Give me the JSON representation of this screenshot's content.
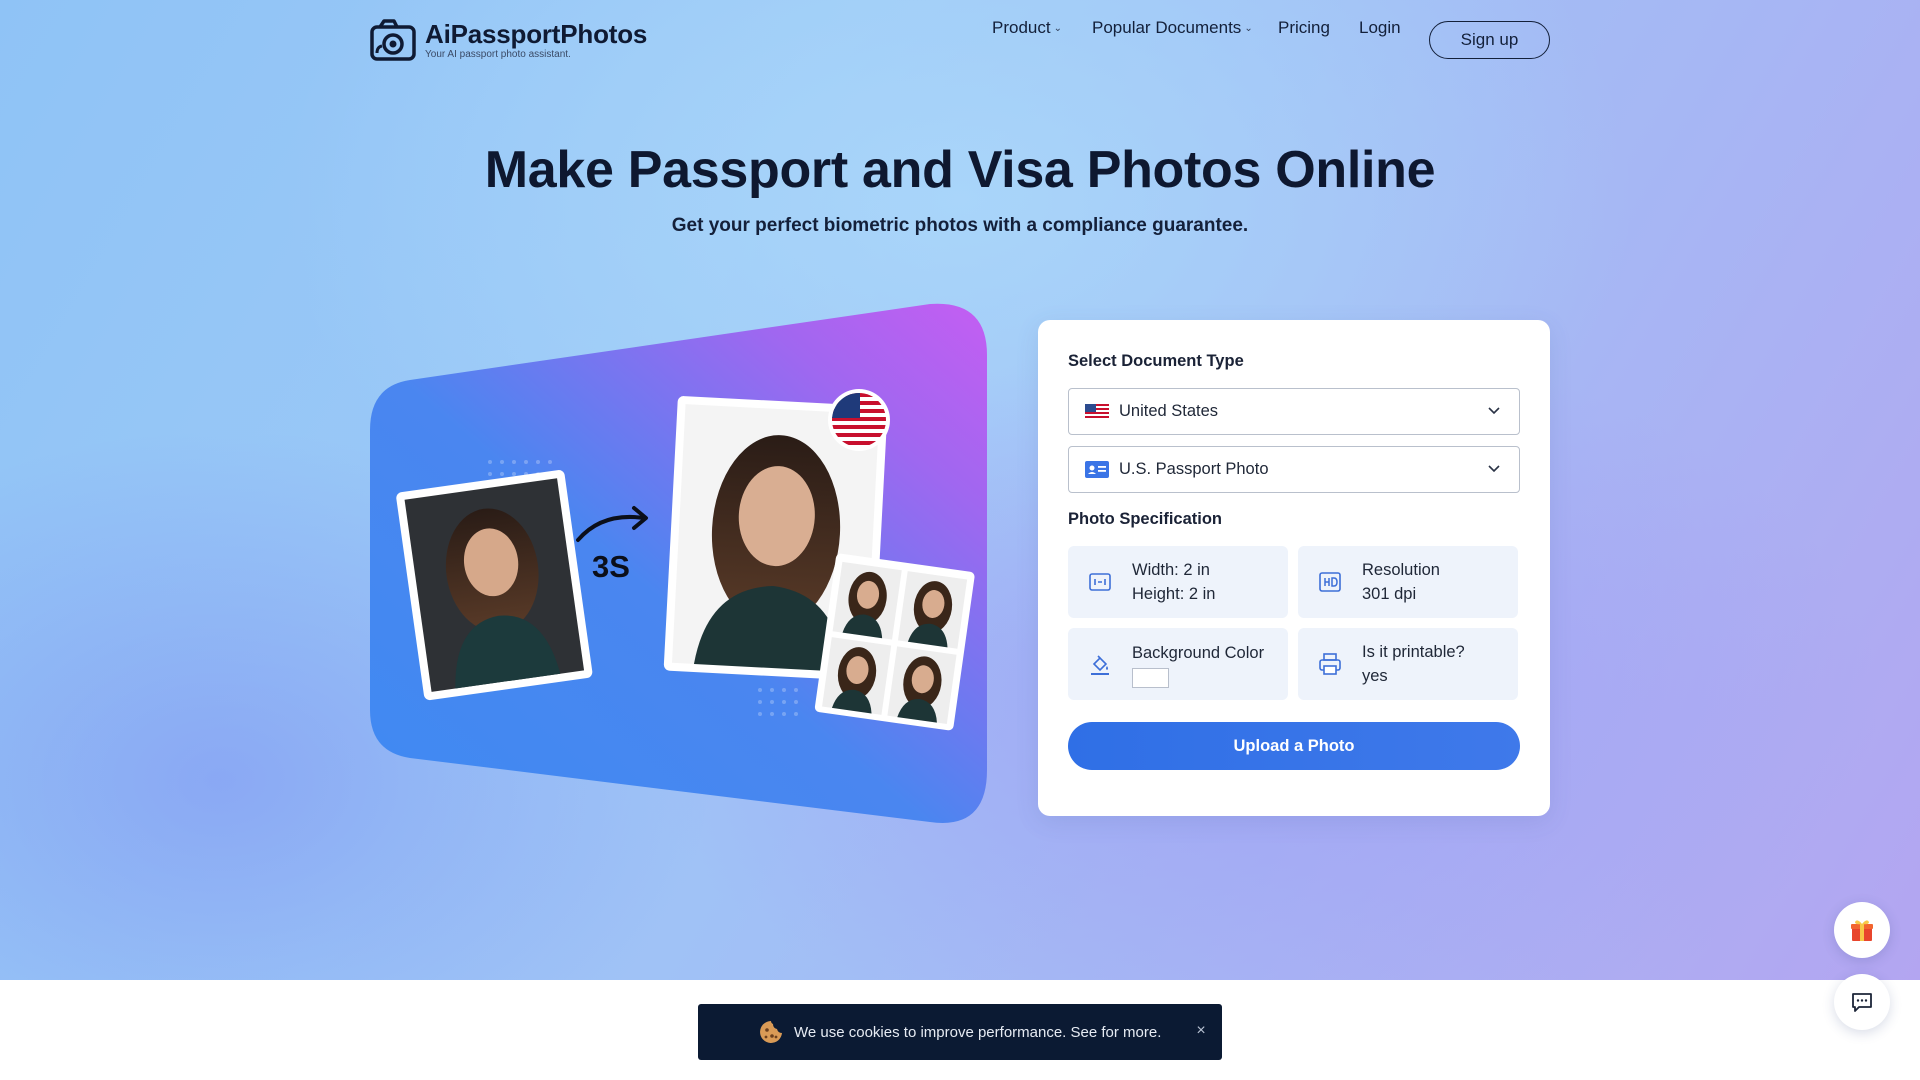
{
  "brand": {
    "name": "AiPassportPhotos",
    "tagline": "Your AI passport photo assistant."
  },
  "nav": {
    "product": "Product",
    "documents": "Popular Documents",
    "pricing": "Pricing",
    "login": "Login",
    "signup": "Sign up"
  },
  "hero": {
    "headline": "Make Passport and Visa Photos Online",
    "subhead": "Get your perfect biometric photos with a compliance guarantee.",
    "illustration_label": "3S"
  },
  "form": {
    "doc_type_title": "Select Document Type",
    "country": "United States",
    "document": "U.S. Passport Photo",
    "spec_title": "Photo Specification",
    "width": "Width: 2 in",
    "height": "Height: 2 in",
    "resolution_label": "Resolution",
    "resolution_value": "301 dpi",
    "background_label": "Background Color",
    "background_color": "#ffffff",
    "printable_label": "Is it printable?",
    "printable_value": "yes",
    "upload": "Upload a Photo"
  },
  "cookie": {
    "text": "We use cookies to improve performance. See for more."
  },
  "colors": {
    "accent": "#2f6fe6",
    "dark": "#0b1a33"
  },
  "icons": [
    "logo-camera-icon",
    "chevron-down-icon",
    "us-flag-icon",
    "id-card-icon",
    "size-icon",
    "hd-icon",
    "paint-bucket-icon",
    "printer-icon",
    "gift-icon",
    "chat-icon",
    "cookie-icon",
    "close-icon"
  ]
}
